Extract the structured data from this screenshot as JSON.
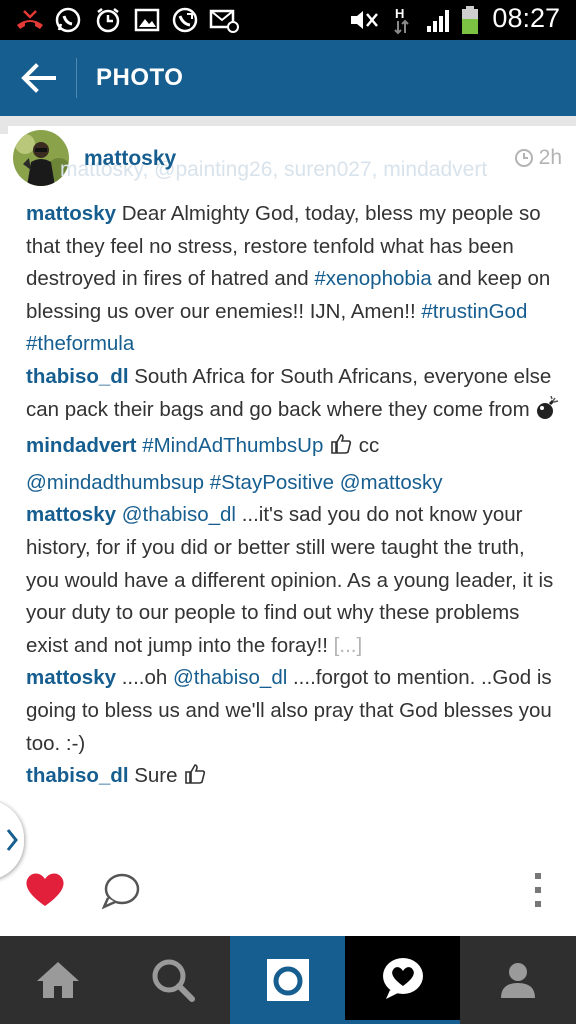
{
  "status_bar": {
    "time": "08:27",
    "icons": [
      "missed-call-icon",
      "whatsapp-icon",
      "alarm-icon",
      "gallery-icon",
      "phone-icon",
      "email-icon",
      "mute-icon",
      "data-h-icon",
      "signal-icon",
      "battery-icon"
    ]
  },
  "app_bar": {
    "title": "PHOTO",
    "back_icon": "back-arrow-icon",
    "color": "#165e8f"
  },
  "post": {
    "owner": "mattosky",
    "tagged_ghost": "mattosky, @painting26, suren027, mindadvert",
    "time": "2h"
  },
  "comments": [
    {
      "user": "mattosky",
      "text": " Dear Almighty God,  today, bless my people so that they feel no stress, restore tenfold what has been destroyed in fires of hatred and ",
      "tag1": "#xenophobia",
      "text2": " and keep on blessing us over our enemies!! IJN, Amen!! ",
      "tag2": "#trustinGod",
      "tag3": "#theformula"
    },
    {
      "user": "thabiso_dl",
      "text": " South Africa for South Africans, everyone else can pack their bags and go back where they come from "
    },
    {
      "user": "mindadvert",
      "tag1": "#MindAdThumbsUp",
      "text": " cc ",
      "tag2": "@mindadthumbsup",
      "tag3": "#StayPositive",
      "tag4": "@mattosky"
    },
    {
      "user": "mattosky",
      "tag1": "@thabiso_dl",
      "text": " ...it's sad you do not know your history, for if you did or better still were taught the truth, you would have a different opinion. As a young leader, it is your duty to our people to find out why these problems exist and not jump into the foray!! ",
      "more": "[...]"
    },
    {
      "user": "mattosky",
      "text": " ....oh ",
      "tag1": "@thabiso_dl",
      "text2": " ....forgot to mention. ..God is going to bless us and we'll also pray that God blesses you too. :-)"
    },
    {
      "user": "thabiso_dl",
      "text": " Sure "
    }
  ],
  "colors": {
    "accent": "#165e8f",
    "like": "#e3203c",
    "tab_active": "#165e8f",
    "tab_bar": "#2f2f2f"
  },
  "tabs": [
    "home-icon",
    "search-icon",
    "camera-icon",
    "activity-icon",
    "profile-icon"
  ]
}
